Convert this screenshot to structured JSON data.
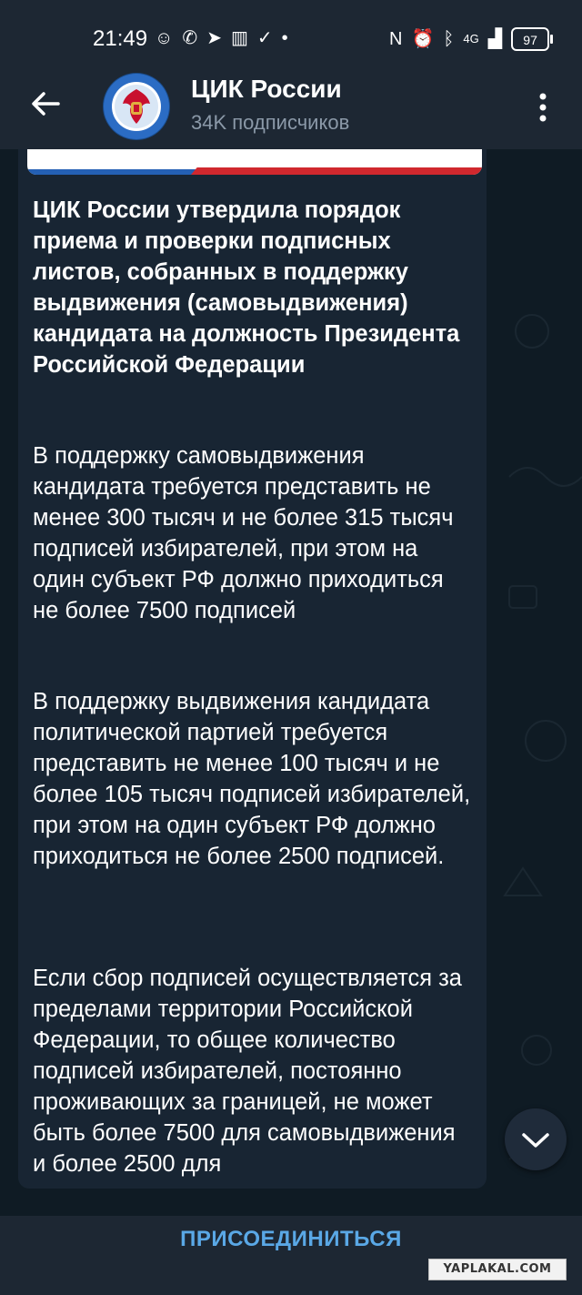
{
  "status_bar": {
    "time": "21:49",
    "battery": "97",
    "network": "4G"
  },
  "header": {
    "title": "ЦИК России",
    "subtitle": "34K подписчиков",
    "back_icon": "arrow-left-icon",
    "menu_icon": "more-vertical-icon"
  },
  "message": {
    "title": "ЦИК России утвердила порядок приема и проверки подписных листов, собранных в поддержку выдвижения (самовыдвижения) кандидата на должность Президента Российской Федерации",
    "paragraphs": [
      "В поддержку самовыдвижения кандидата требуется представить не менее 300 тысяч и не более 315 тысяч подписей избирателей, при этом на один субъект РФ должно приходиться не более 7500 подписей",
      "В поддержку выдвижения кандидата политической партией требуется представить не менее 100 тысяч и не более 105 тысяч подписей избирателей, при этом на один субъект РФ должно приходиться не более 2500 подписей.",
      "Если сбор подписей осуществляется за пределами территории Российской Федерации, то общее количество подписей избирателей, постоянно проживающих за границей, не может быть более 7500 для самовыдвижения и более 2500 для"
    ]
  },
  "bottom_bar": {
    "join_label": "ПРИСОЕДИНИТЬСЯ"
  },
  "watermark": "YAPLAKAL.COM",
  "colors": {
    "accent": "#5aa8e6",
    "header_bg": "#1d2733",
    "bubble_bg": "#182533",
    "chat_bg": "#0f1b24"
  }
}
